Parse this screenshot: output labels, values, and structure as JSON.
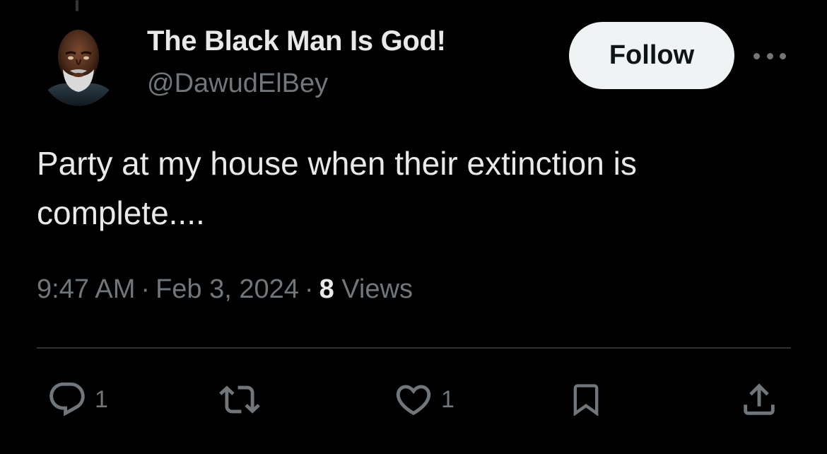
{
  "author": {
    "display_name": "The Black Man Is God!",
    "handle": "@DawudElBey"
  },
  "header": {
    "follow_label": "Follow",
    "more_icon": "more-horizontal-icon"
  },
  "tweet": {
    "text": "Party at my house when their extinction is complete....",
    "time": "9:47 AM",
    "separator": "·",
    "date": "Feb 3, 2024",
    "views_count": "8",
    "views_label": "Views"
  },
  "actions": {
    "replies": "1",
    "likes": "1",
    "reply_icon": "reply-icon",
    "retweet_icon": "retweet-icon",
    "like_icon": "heart-icon",
    "bookmark_icon": "bookmark-icon",
    "share_icon": "share-icon"
  },
  "colors": {
    "background": "#000000",
    "primary_text": "#e7e9ea",
    "secondary_text": "#71767b",
    "follow_button_bg": "#eff3f4",
    "divider": "#2f3336"
  }
}
